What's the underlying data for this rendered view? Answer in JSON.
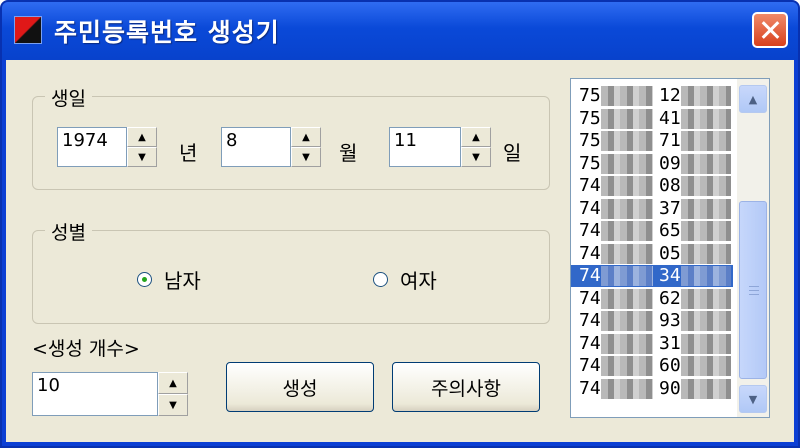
{
  "window": {
    "title": "주민등록번호 생성기",
    "close_icon": "close-icon"
  },
  "birth": {
    "legend": "생일",
    "year": "1974",
    "year_unit": "년",
    "month": "8",
    "month_unit": "월",
    "day": "11",
    "day_unit": "일"
  },
  "gender": {
    "legend": "성별",
    "options": [
      {
        "label": "남자",
        "selected": true
      },
      {
        "label": "여자",
        "selected": false
      }
    ]
  },
  "count": {
    "label": "<생성 개수>",
    "value": "10"
  },
  "buttons": {
    "generate": "생성",
    "notice": "주의사항"
  },
  "list": {
    "selected_index": 8,
    "items": [
      {
        "a": "75",
        "b": "12"
      },
      {
        "a": "75",
        "b": "41"
      },
      {
        "a": "75",
        "b": "71"
      },
      {
        "a": "75",
        "b": "09"
      },
      {
        "a": "74",
        "b": "08"
      },
      {
        "a": "74",
        "b": "37"
      },
      {
        "a": "74",
        "b": "65"
      },
      {
        "a": "74",
        "b": "05"
      },
      {
        "a": "74",
        "b": "34"
      },
      {
        "a": "74",
        "b": "62"
      },
      {
        "a": "74",
        "b": "93"
      },
      {
        "a": "74",
        "b": "31"
      },
      {
        "a": "74",
        "b": "60"
      },
      {
        "a": "74",
        "b": "90"
      }
    ]
  },
  "colors": {
    "titlebar": "#0a49d8",
    "client": "#ece9d8",
    "selection": "#3168c9"
  }
}
